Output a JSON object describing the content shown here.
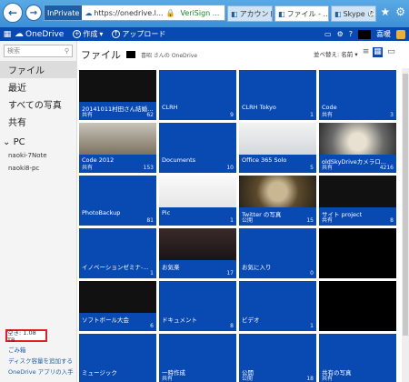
{
  "browser": {
    "inprivate_label": "InPrivate",
    "url": "https://onedrive.l...",
    "verisign": "VeriSign ...",
    "tabs": [
      {
        "label": "アカウント",
        "active": false
      },
      {
        "label": "ファイル - ...",
        "active": true
      },
      {
        "label": "Skype の入手",
        "active": false
      }
    ]
  },
  "topbar": {
    "logo": "OneDrive",
    "create_label": "作成",
    "upload_label": "アップロード",
    "user_suffix": "喜暖"
  },
  "sidebar": {
    "search_placeholder": "検索",
    "items": [
      "ファイル",
      "最近",
      "すべての写真",
      "共有"
    ],
    "pc_header": "PC",
    "pcs": [
      "naoki-7Note",
      "naoki8-pc"
    ],
    "quota": "空き: 1.08 TB",
    "links": [
      "ごみ箱",
      "ディスク容量を追加する",
      "OneDrive アプリの入手"
    ]
  },
  "main": {
    "title": "ファイル",
    "owner": "喜昭 さんの OneDrive",
    "sort_label": "並べ替え: 名前 ▾"
  },
  "tiles": [
    {
      "name": "20141011村田さん結婚式-...",
      "shared": "共有",
      "count": "62",
      "style": "photo-dark"
    },
    {
      "name": "CLRH",
      "shared": "",
      "count": "9",
      "style": "plain"
    },
    {
      "name": "CLRH Tokyo",
      "shared": "",
      "count": "1",
      "style": "plain"
    },
    {
      "name": "Code",
      "shared": "共有",
      "count": "3",
      "style": "plain"
    },
    {
      "name": "Code 2012",
      "shared": "共有",
      "count": "153",
      "style": "photo-room"
    },
    {
      "name": "Documents",
      "shared": "",
      "count": "10",
      "style": "plain"
    },
    {
      "name": "Office 365 Solo",
      "shared": "",
      "count": "5",
      "style": "photo-screen"
    },
    {
      "name": "oldSkyDriveカメラロ...",
      "shared": "共有",
      "count": "4216",
      "style": "photo-food"
    },
    {
      "name": "PhotoBackup",
      "shared": "",
      "count": "81",
      "style": "plain"
    },
    {
      "name": "Pic",
      "shared": "",
      "count": "1",
      "style": "photo-doc"
    },
    {
      "name": "Twitter の写真",
      "shared": "公開",
      "count": "15",
      "style": "photo-bowl"
    },
    {
      "name": "サイト project",
      "shared": "共有",
      "count": "8",
      "style": "photo-dark"
    },
    {
      "name": "イノベーションゼミナ-ハンズ-",
      "shared": "",
      "count": "1",
      "style": "plain"
    },
    {
      "name": "お気楽",
      "shared": "",
      "count": "17",
      "style": "photo-anime"
    },
    {
      "name": "お気に入り",
      "shared": "",
      "count": "0",
      "style": "plain"
    },
    {
      "name": "",
      "shared": "",
      "count": "",
      "style": "black"
    },
    {
      "name": "ソフトボール大会",
      "shared": "",
      "count": "6",
      "style": "photo-dark"
    },
    {
      "name": "ドキュメント",
      "shared": "",
      "count": "8",
      "style": "plain"
    },
    {
      "name": "ビデオ",
      "shared": "",
      "count": "1",
      "style": "plain"
    },
    {
      "name": "",
      "shared": "",
      "count": "",
      "style": "black"
    },
    {
      "name": "ミュージック",
      "shared": "",
      "count": "",
      "style": "plain"
    },
    {
      "name": "一時作成",
      "shared": "共有",
      "count": "",
      "style": "plain"
    },
    {
      "name": "公開",
      "shared": "公開",
      "count": "18",
      "style": "plain"
    },
    {
      "name": "共有の写真",
      "shared": "共有",
      "count": "",
      "style": "plain"
    }
  ]
}
